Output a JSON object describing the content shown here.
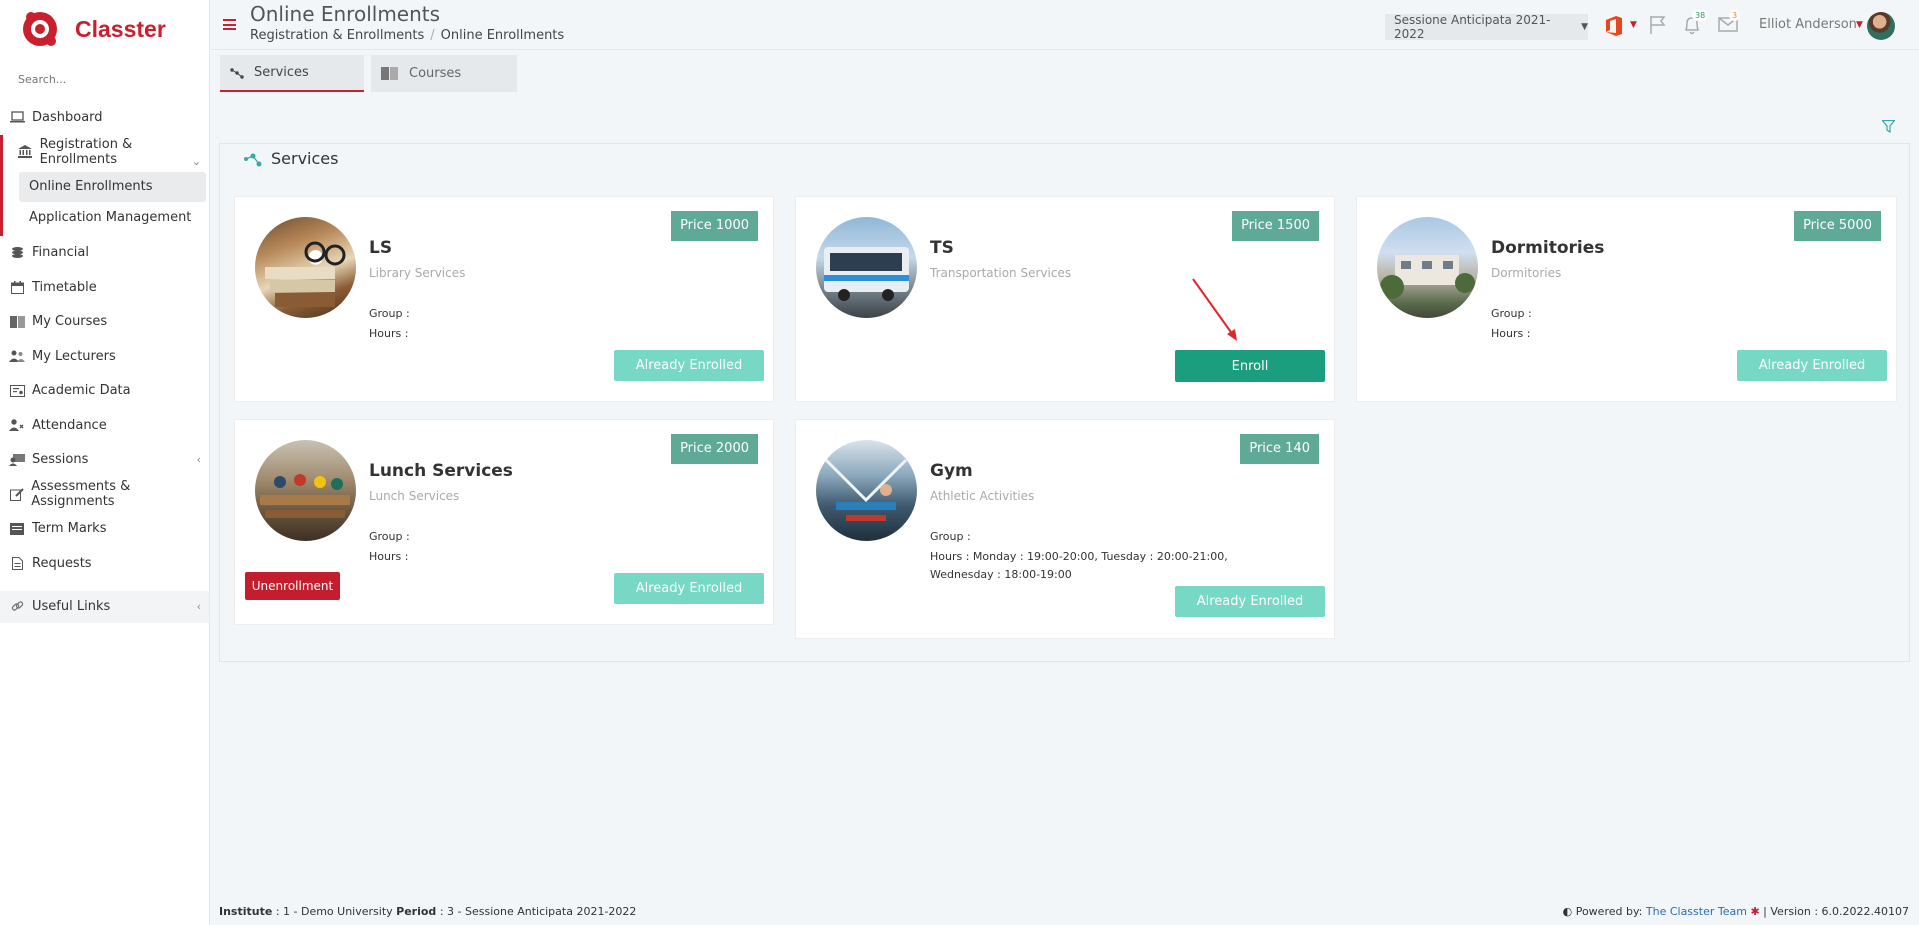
{
  "app": {
    "name": "Classter"
  },
  "sidebar": {
    "search_placeholder": "Search...",
    "items": [
      {
        "label": "Dashboard",
        "icon": "laptop-icon"
      },
      {
        "label": "Registration & Enrollments",
        "icon": "institution-icon"
      },
      {
        "label": "Financial",
        "icon": "coins-icon"
      },
      {
        "label": "Timetable",
        "icon": "calendar-icon"
      },
      {
        "label": "My Courses",
        "icon": "book-icon"
      },
      {
        "label": "My Lecturers",
        "icon": "users-icon"
      },
      {
        "label": "Academic Data",
        "icon": "certificate-icon"
      },
      {
        "label": "Attendance",
        "icon": "user-check-icon"
      },
      {
        "label": "Sessions",
        "icon": "sessions-icon"
      },
      {
        "label": "Assessments & Assignments",
        "icon": "edit-icon"
      },
      {
        "label": "Term Marks",
        "icon": "marks-icon"
      },
      {
        "label": "Requests",
        "icon": "file-icon"
      },
      {
        "label": "Useful Links",
        "icon": "link-icon"
      }
    ],
    "sub_items": [
      {
        "label": "Online Enrollments"
      },
      {
        "label": "Application Management"
      }
    ]
  },
  "header": {
    "title": "Online Enrollments",
    "breadcrumb": [
      "Registration & Enrollments",
      "Online Enrollments"
    ],
    "session": "Sessione Anticipata 2021-2022",
    "notifications_count": "38",
    "messages_count": "3",
    "user_name": "Elliot Anderson"
  },
  "tabs": [
    {
      "label": "Services"
    },
    {
      "label": "Courses"
    }
  ],
  "section": {
    "title": "Services"
  },
  "cards": [
    {
      "name": "LS",
      "description": "Library Services",
      "price": "Price 1000",
      "group": "Group :",
      "hours": "Hours :",
      "action": "Already Enrolled"
    },
    {
      "name": "TS",
      "description": "Transportation Services",
      "price": "Price 1500",
      "group": "",
      "hours": "",
      "action": "Enroll"
    },
    {
      "name": "Dormitories",
      "description": "Dormitories",
      "price": "Price 5000",
      "group": "Group :",
      "hours": "Hours :",
      "action": "Already Enrolled"
    },
    {
      "name": "Lunch Services",
      "description": "Lunch Services",
      "price": "Price 2000",
      "group": "Group :",
      "hours": "Hours :",
      "action": "Already Enrolled",
      "secondary_action": "Unenrollment"
    },
    {
      "name": "Gym",
      "description": "Athletic Activities",
      "price": "Price 140",
      "group": "Group :",
      "hours": "Hours : Monday : 19:00-20:00, Tuesday : 20:00-21:00, Wednesday : 18:00-19:00",
      "action": "Already Enrolled"
    }
  ],
  "footer": {
    "institute_label": "Institute",
    "institute_value": ": 1 - Demo University",
    "period_label": "Period",
    "period_value": ": 3 - Sessione Anticipata 2021-2022",
    "powered_by": "Powered by:",
    "team": "The Classter Team",
    "version": "| Version : 6.0.2022.40107"
  },
  "colors": {
    "brand": "#c8202f",
    "enroll": "#1a9e7d",
    "enrolled": "#76d8c5",
    "price": "#5faa96"
  }
}
